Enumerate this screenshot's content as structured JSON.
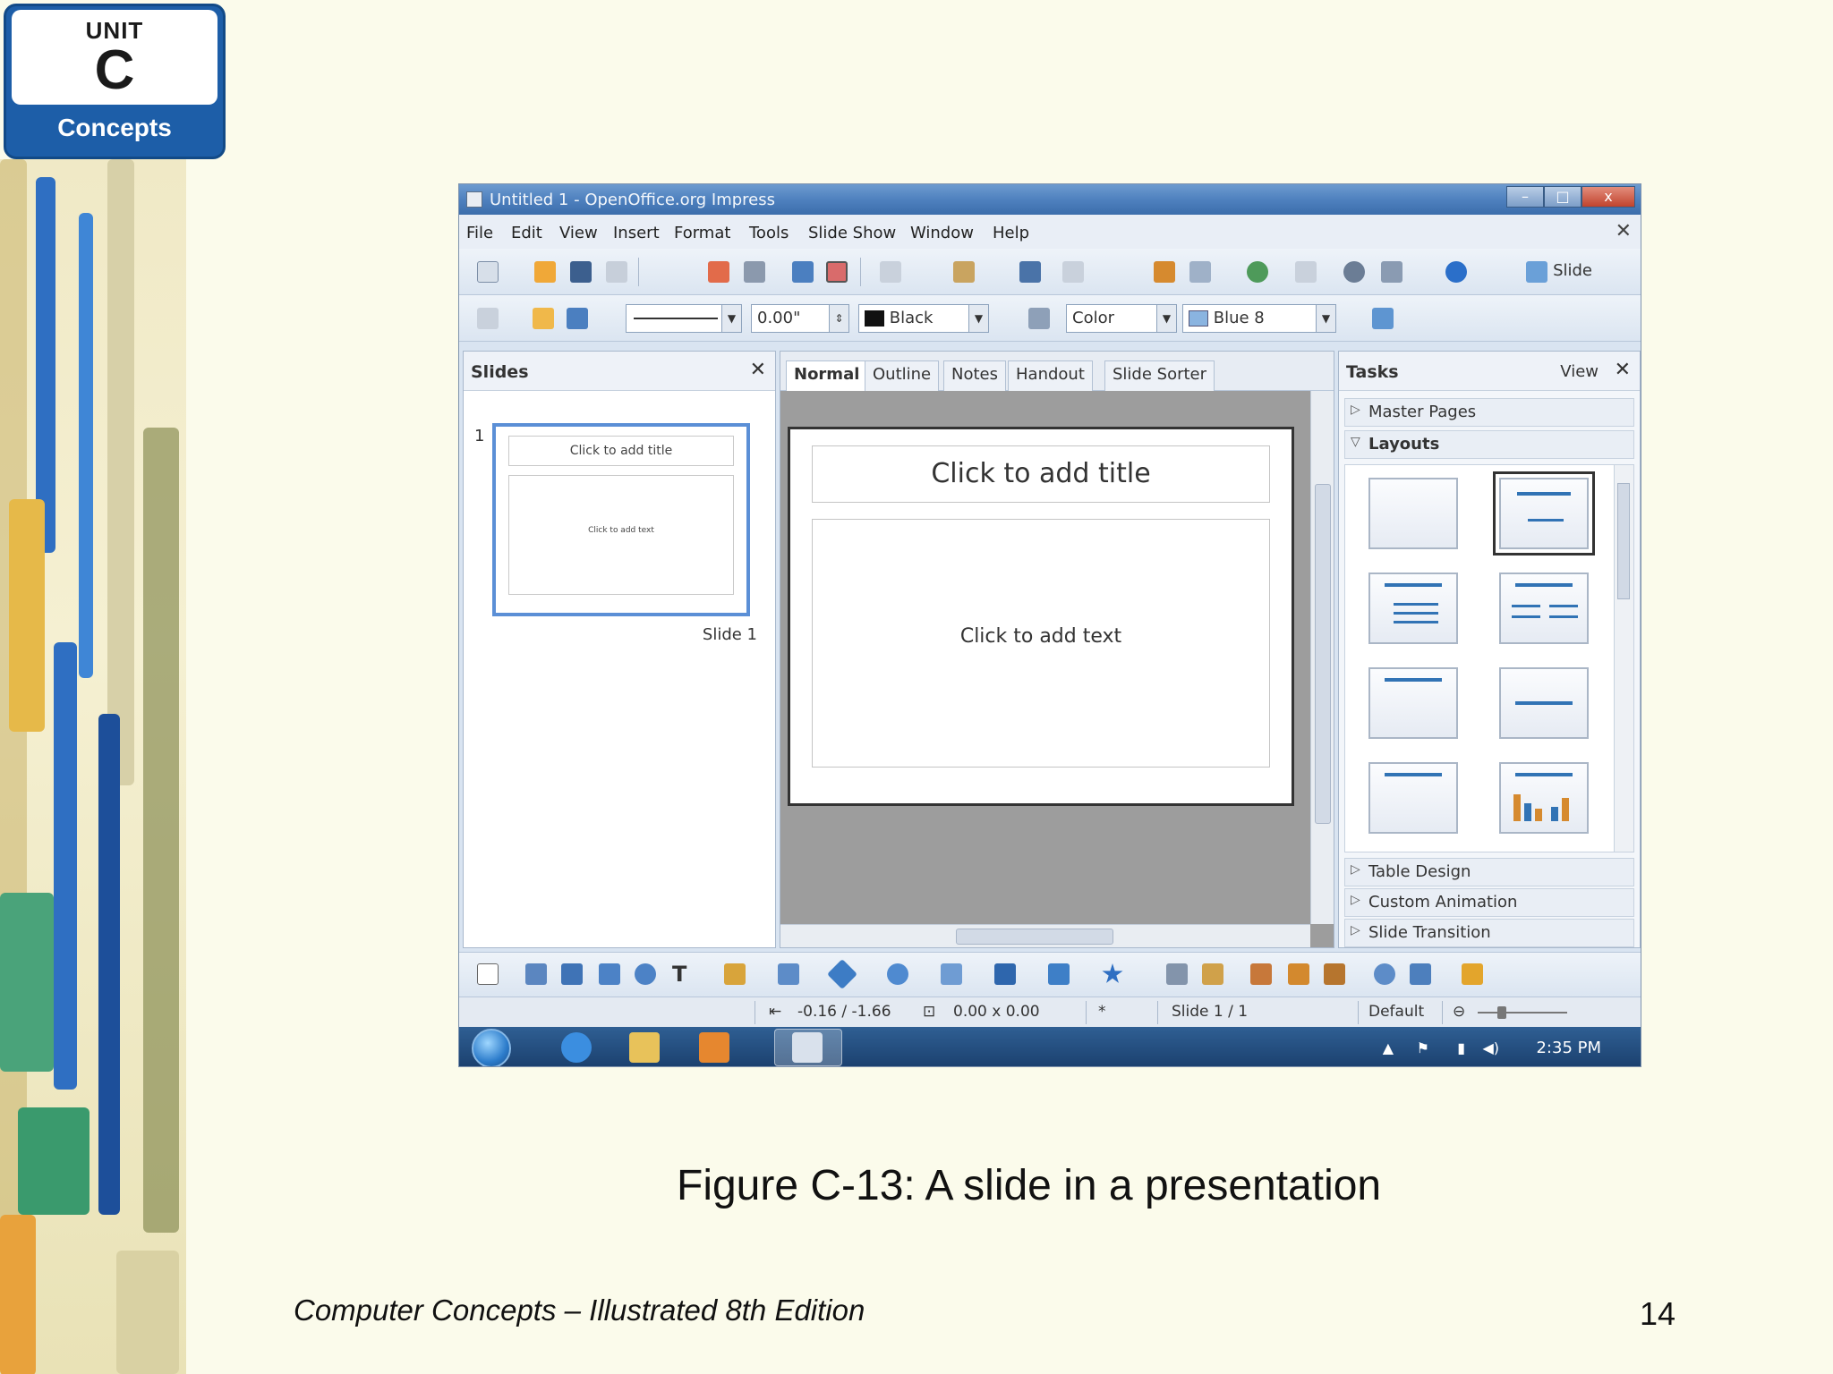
{
  "badge": {
    "unit": "UNIT",
    "letter": "C",
    "label": "Concepts"
  },
  "window": {
    "title": "Untitled 1 - OpenOffice.org Impress",
    "controls": [
      "–",
      "□",
      "x"
    ]
  },
  "menu": [
    "File",
    "Edit",
    "View",
    "Insert",
    "Format",
    "Tools",
    "Slide Show",
    "Window",
    "Help"
  ],
  "toolbar": {
    "slide_label": "Slide",
    "line_width": "0.00\"",
    "line_color": "Black",
    "area_style": "Color",
    "area_color": "Blue 8"
  },
  "slides_pane": {
    "title": "Slides",
    "thumb_number": "1",
    "thumb_title": "Click to add title",
    "thumb_body": "Click to add text",
    "thumb_label": "Slide 1"
  },
  "tabs": [
    "Normal",
    "Outline",
    "Notes",
    "Handout",
    "Slide Sorter"
  ],
  "slide": {
    "title_placeholder": "Click to add title",
    "body_placeholder": "Click to add text"
  },
  "tasks": {
    "title": "Tasks",
    "view": "View",
    "sections": [
      "Master Pages",
      "Layouts",
      "Table Design",
      "Custom Animation",
      "Slide Transition"
    ]
  },
  "status": {
    "position": "-0.16 / -1.66",
    "size": "0.00 x 0.00",
    "slide": "Slide 1 / 1",
    "master": "Default"
  },
  "taskbar": {
    "clock": "2:35 PM"
  },
  "caption": "Figure C-13: A slide in a presentation",
  "footer": {
    "book": "Computer Concepts – Illustrated 8th Edition",
    "page": "14"
  }
}
